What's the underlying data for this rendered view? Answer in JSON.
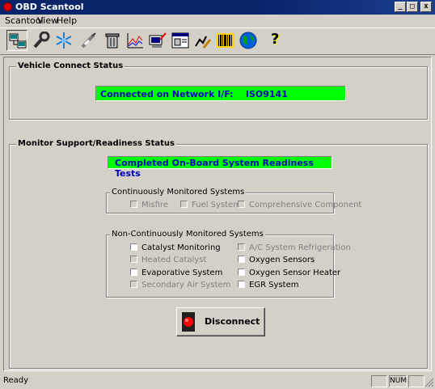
{
  "window": {
    "title": "OBD Scantool",
    "min": "_",
    "max": "□",
    "close": "x"
  },
  "menu": {
    "items": [
      "Scantool",
      "View",
      "Help"
    ]
  },
  "toolbar": {
    "icons": [
      "connect-icon",
      "wrench-icon",
      "snowflake-icon",
      "spark-plug-icon",
      "trash-can-icon",
      "chart-icon",
      "monitor-pencil-icon",
      "window-doc-icon",
      "graph-pencil-icon",
      "barcode-icon",
      "globe-icon",
      "help-icon"
    ],
    "help_label": "?"
  },
  "vehicle": {
    "group_label": "Vehicle Connect Status",
    "status_text": "Connected on Network I/F:    ISO9141"
  },
  "monitor": {
    "group_label": "Monitor Support/Readiness Status",
    "status_text": "Completed On-Board System Readiness Tests",
    "continuous": {
      "label": "Continuously Monitored Systems",
      "items": [
        "Misfire",
        "Fuel System",
        "Comprehensive Component"
      ]
    },
    "noncontinuous": {
      "label": "Non-Continuously Monitored Systems",
      "items": [
        "Catalyst Monitoring",
        "Heated Catalyst",
        "Evaporative System",
        "Secondary Air System",
        "A/C System Refrigeration",
        "Oxygen Sensors",
        "Oxygen Sensor Heater",
        "EGR System"
      ]
    }
  },
  "action": {
    "disconnect_label": "Disconnect"
  },
  "status": {
    "ready": "Ready",
    "num": "NUM"
  },
  "colors": {
    "status_green": "#00ff00",
    "status_text": "#0000c0",
    "titlebar": "#0a246a",
    "lamp_red": "#ff0000"
  }
}
